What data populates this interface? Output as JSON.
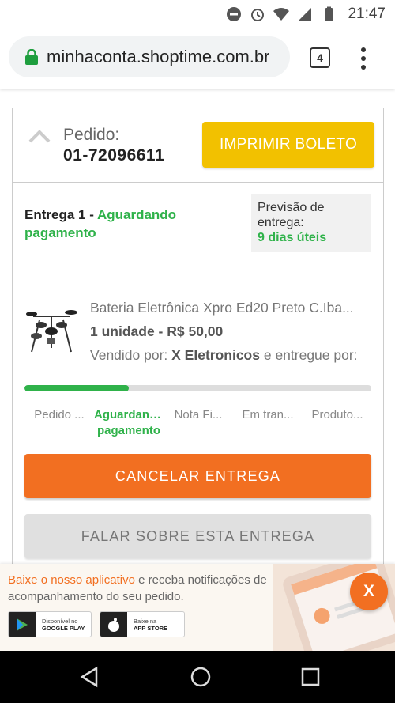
{
  "statusbar": {
    "time": "21:47"
  },
  "browser": {
    "url": "minhaconta.shoptime.com.br",
    "tab_count": "4"
  },
  "order": {
    "label": "Pedido:",
    "number": "01-72096611",
    "print_button": "IMPRIMIR BOLETO"
  },
  "delivery": {
    "title": "Entrega 1 - ",
    "status": "Aguardando pagamento",
    "forecast_label": "Previsão de entrega:",
    "forecast_value": "9 dias úteis"
  },
  "product": {
    "name": "Bateria Eletrônica Xpro Ed20 Preto C.Iba...",
    "quantity_price": "1 unidade - R$ 50,00",
    "seller_prefix": "Vendido por: ",
    "seller": "X Eletronicos",
    "seller_suffix": " e entregue por:"
  },
  "progress": {
    "fraction": 0.3,
    "color": "#2fb24a"
  },
  "steps": [
    {
      "label": "Pedido ..."
    },
    {
      "label": "Aguardando pagamento"
    },
    {
      "label": "Nota Fi..."
    },
    {
      "label": "Em tran..."
    },
    {
      "label": "Produto..."
    }
  ],
  "actions": {
    "cancel": "CANCELAR ENTREGA",
    "talk": "FALAR SOBRE ESTA ENTREGA"
  },
  "app_banner": {
    "highlight": "Baixe o nosso aplicativo",
    "text": " e receba notificações de acompanhamento do seu pedido.",
    "google_small": "Disponível no",
    "google_big": "GOOGLE PLAY",
    "apple_small": "Baixe na",
    "apple_big": "APP STORE",
    "close": "X"
  },
  "colors": {
    "accent_orange": "#f26f21",
    "accent_yellow": "#f2c100",
    "status_green": "#2fb24a"
  }
}
